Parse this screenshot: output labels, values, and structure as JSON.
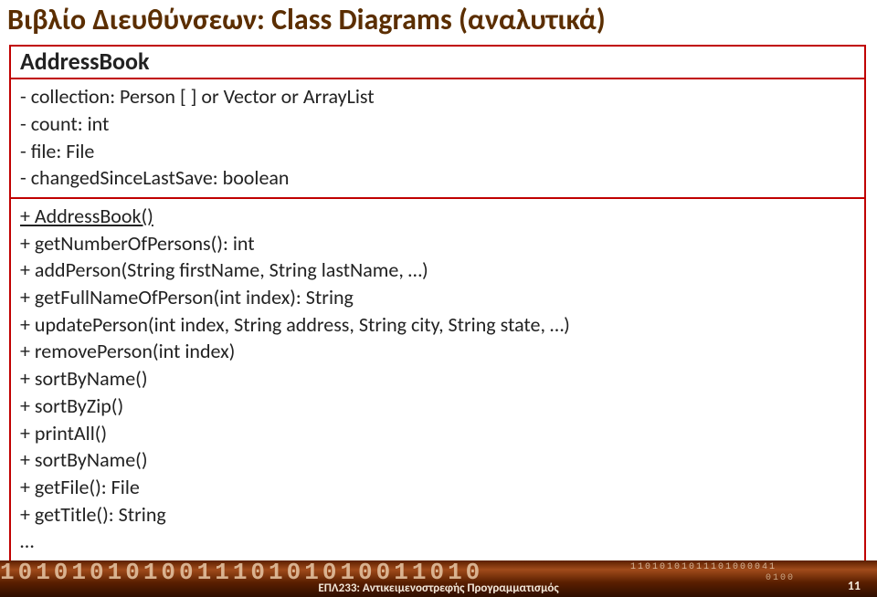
{
  "title": "Βιβλίο Διευθύνσεων: Class Diagrams (αναλυτικά)",
  "class": {
    "name": "AddressBook",
    "attrs": [
      "- collection: Person [ ] or Vector or ArrayList",
      "- count: int",
      "- file: File",
      "- changedSinceLastSave: boolean"
    ],
    "ops": [
      "+ AddressBook()",
      "+ getNumberOfPersons(): int",
      "+ addPerson(String firstName, String lastName, …)",
      "+ getFullNameOfPerson(int index): String",
      "+ updatePerson(int index, String address, String city, String state, …)",
      "+ removePerson(int index)",
      "+ sortByName()",
      "+ sortByZip()",
      "+ printAll()",
      "+ sortByName()",
      "+ getFile(): File",
      "+ getTitle(): String",
      "…"
    ]
  },
  "footer": {
    "bits_big": "101010101001110101010011010",
    "bits_sm1": "11010101011101000041",
    "bits_sm2": "0100",
    "text": "ΕΠΛ233: Αντικειμενοστρεφής Προγραμματισμός",
    "page": "11"
  }
}
